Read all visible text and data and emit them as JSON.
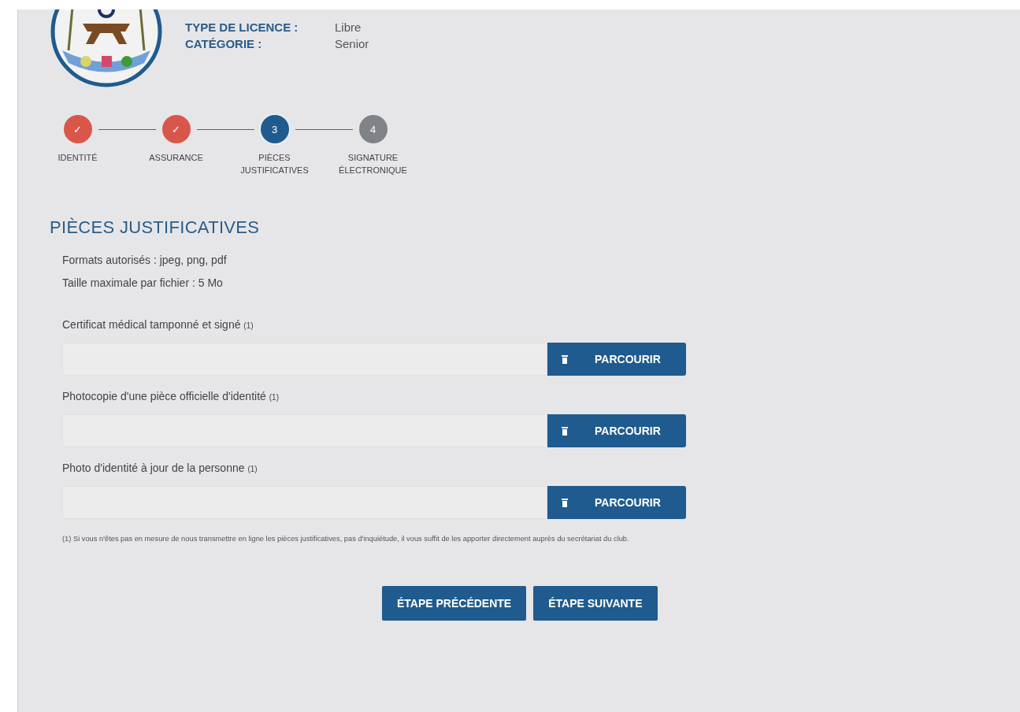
{
  "info": [
    {
      "label": "TYPE DE LICENCE :",
      "value": "Libre"
    },
    {
      "label": "CATÉGORIE :",
      "value": "Senior"
    }
  ],
  "steps": [
    {
      "mark": "✓",
      "label": "IDENTITÉ",
      "completed": true,
      "selected": false
    },
    {
      "mark": "✓",
      "label": "ASSURANCE",
      "completed": true,
      "selected": false
    },
    {
      "mark": "3",
      "label": "PIÈCES JUSTIFICATIVES",
      "completed": false,
      "selected": true
    },
    {
      "mark": "4",
      "label": "SIGNATURE ÉLECTRONIQUE",
      "completed": false,
      "selected": false
    }
  ],
  "heading": "PIÈCES JUSTIFICATIVES",
  "notes": [
    "Formats autorisés : jpeg, png, pdf",
    "Taille maximale par fichier : 5 Mo"
  ],
  "uploads": [
    {
      "label": "Certificat médical tamponné et signé",
      "note": "(1)",
      "button": "PARCOURIR"
    },
    {
      "label": "Photocopie d'une pièce officielle d'identité",
      "note": "(1)",
      "button": "PARCOURIR"
    },
    {
      "label": "Photo d'identité à jour de la personne",
      "note": "(1)",
      "button": "PARCOURIR"
    }
  ],
  "footnote": "(1) Si vous n'êtes pas en mesure de nous transmettre en ligne les pièces justificatives, pas d'inquiétude, il vous suffit de les apporter directement auprès du secrétariat du club.",
  "buttons": [
    "ÉTAPE PRÉCÉDENTE",
    "ÉTAPE SUIVANTE"
  ]
}
